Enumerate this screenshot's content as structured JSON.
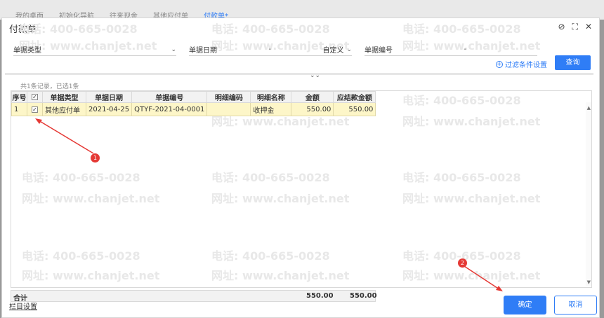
{
  "background": {
    "tabs": [
      "我的桌面",
      "初始化导航",
      "往来现金",
      "其他应付单",
      "付款单*"
    ]
  },
  "dialog": {
    "title": "付款单",
    "icons": [
      "help-icon",
      "maximize-icon",
      "close-icon"
    ]
  },
  "filters": {
    "doc_type_label": "单据类型",
    "doc_date_label": "单据日期",
    "doc_date_sep": "-",
    "date_mode": "自定义",
    "doc_no_label": "单据编号",
    "doc_no_sep": "-",
    "advanced_label": "过滤条件设置",
    "query_label": "查询"
  },
  "record_info": "共1条记录，已选1条",
  "grid": {
    "columns": [
      "序号",
      "",
      "单据类型",
      "单据日期",
      "单据编号",
      "明细编码",
      "明细名称",
      "金额",
      "应结款金额"
    ],
    "rows": [
      {
        "seq": "1",
        "type": "其他应付单",
        "date": "2021-04-25",
        "no": "QTYF-2021-04-0001",
        "code": "",
        "name": "收押金",
        "amount": "550.00",
        "due": "550.00"
      }
    ],
    "total_label": "合计",
    "total_amount": "550.00",
    "total_due": "550.00"
  },
  "footer": {
    "column_settings": "栏目设置",
    "confirm": "确定",
    "cancel": "取消"
  },
  "watermark": {
    "phone": "电话: 400-665-0028",
    "site": "网址: www.chanjet.net"
  },
  "annotations": [
    "1",
    "2"
  ],
  "colors": {
    "accent": "#2f7df6",
    "annotation": "#e53935",
    "selected_row": "#fdf6c8"
  }
}
